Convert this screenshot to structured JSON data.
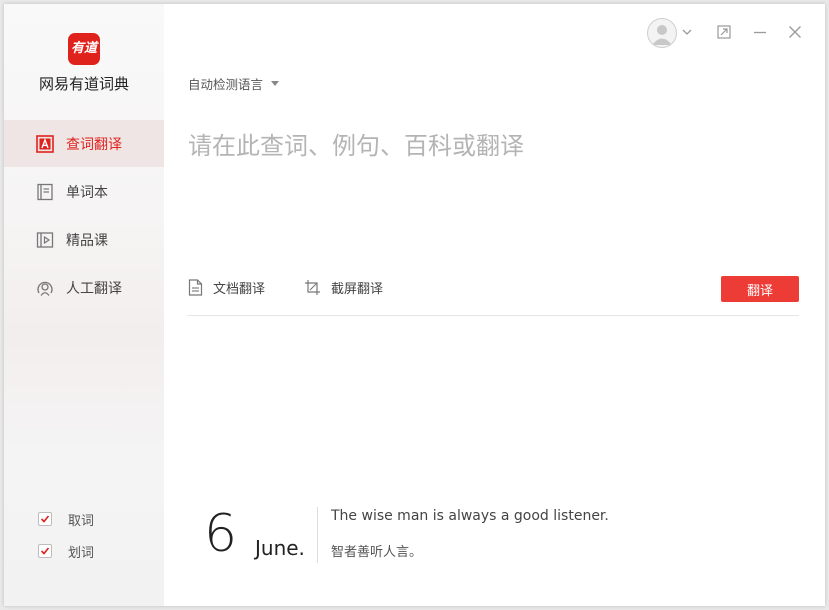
{
  "app": {
    "logo_text": "有道",
    "title": "网易有道词典"
  },
  "sidebar": {
    "items": [
      {
        "label": "查词翻译",
        "icon": "dictionary-a-icon",
        "active": true
      },
      {
        "label": "单词本",
        "icon": "wordbook-icon",
        "active": false
      },
      {
        "label": "精品课",
        "icon": "course-play-icon",
        "active": false
      },
      {
        "label": "人工翻译",
        "icon": "human-translate-icon",
        "active": false
      }
    ],
    "options": [
      {
        "label": "取词",
        "checked": true
      },
      {
        "label": "划词",
        "checked": true
      }
    ]
  },
  "header": {
    "window_buttons": [
      "restore-icon",
      "minimize-icon",
      "close-icon"
    ]
  },
  "translate": {
    "language": "自动检测语言",
    "placeholder": "请在此查词、例句、百科或翻译",
    "value": "",
    "doc_translate": "文档翻译",
    "screenshot_translate": "截屏翻译",
    "translate_button": "翻译"
  },
  "daily": {
    "day": "6",
    "month": "June.",
    "quote_en": "The wise man is always a good listener.",
    "quote_zh": "智者善听人言。"
  },
  "colors": {
    "accent": "#e0221c",
    "button": "#ed3b35",
    "active_bg": "#efe5e5"
  }
}
